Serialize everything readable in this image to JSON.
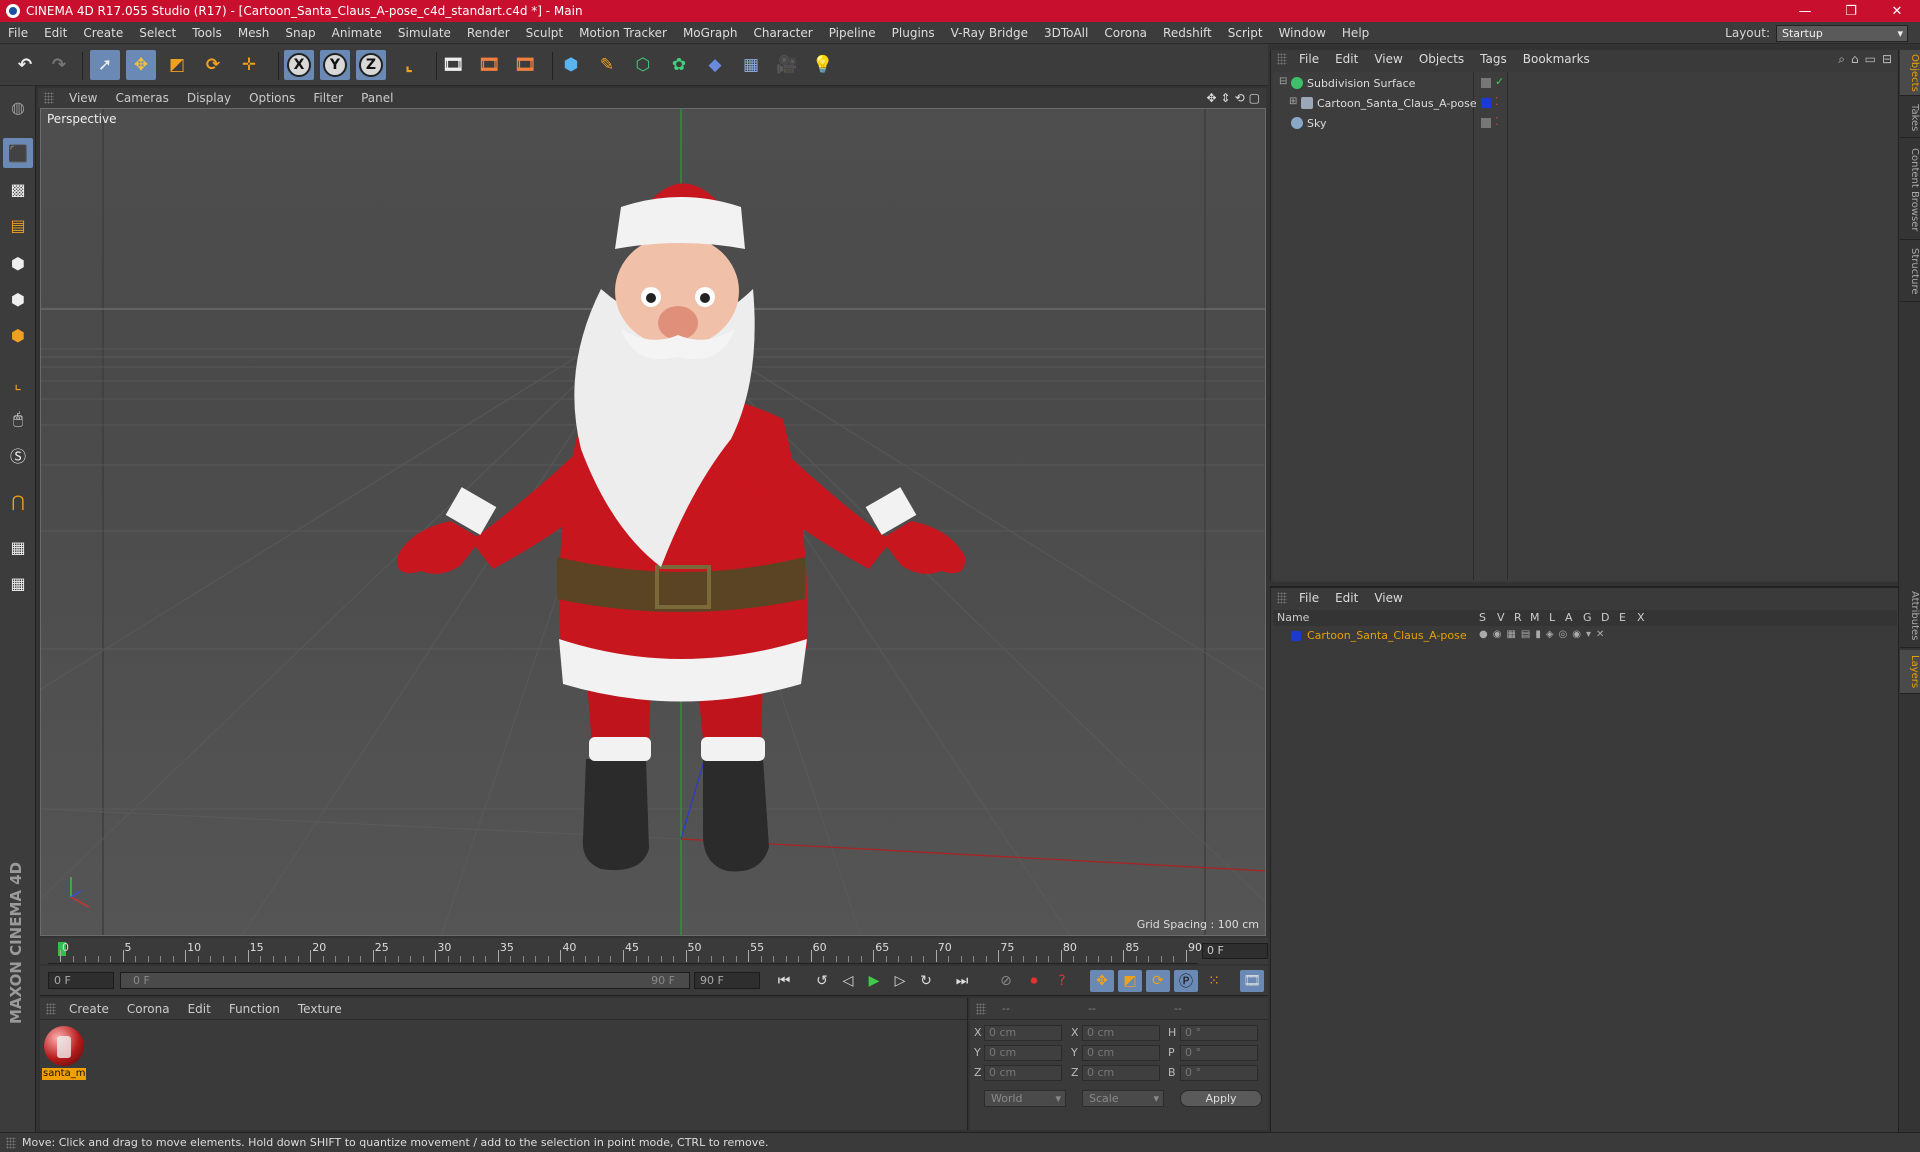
{
  "window": {
    "title": "CINEMA 4D R17.055 Studio (R17) - [Cartoon_Santa_Claus_A-pose_c4d_standart.c4d *] - Main",
    "controls": [
      "—",
      "❐",
      "✕"
    ]
  },
  "menubar": {
    "items": [
      "File",
      "Edit",
      "Create",
      "Select",
      "Tools",
      "Mesh",
      "Snap",
      "Animate",
      "Simulate",
      "Render",
      "Sculpt",
      "Motion Tracker",
      "MoGraph",
      "Character",
      "Pipeline",
      "Plugins",
      "V-Ray Bridge",
      "3DToAll",
      "Corona",
      "Redshift",
      "Script",
      "Window",
      "Help"
    ],
    "layout_label": "Layout:",
    "layout_value": "Startup"
  },
  "toolbar": {
    "axes": [
      "X",
      "Y",
      "Z"
    ]
  },
  "viewport": {
    "menu": [
      "View",
      "Cameras",
      "Display",
      "Options",
      "Filter",
      "Panel"
    ],
    "camera_label": "Perspective",
    "grid_spacing": "Grid Spacing : 100 cm"
  },
  "timeline": {
    "ticks": [
      0,
      5,
      10,
      15,
      20,
      25,
      30,
      35,
      40,
      45,
      50,
      55,
      60,
      65,
      70,
      75,
      80,
      85,
      90
    ],
    "current_frame": "0 F"
  },
  "transport": {
    "start_field": "0 F",
    "range_start": "0 F",
    "range_end": "90 F",
    "end_field": "90 F"
  },
  "material_panel": {
    "menu": [
      "Create",
      "Corona",
      "Edit",
      "Function",
      "Texture"
    ],
    "material_name": "santa_m"
  },
  "coord_panel": {
    "head": [
      "--",
      "--",
      "--"
    ],
    "rows": [
      {
        "a": "X",
        "v1": "0 cm",
        "b": "X",
        "v2": "0 cm",
        "c": "H",
        "v3": "0 °"
      },
      {
        "a": "Y",
        "v1": "0 cm",
        "b": "Y",
        "v2": "0 cm",
        "c": "P",
        "v3": "0 °"
      },
      {
        "a": "Z",
        "v1": "0 cm",
        "b": "Z",
        "v2": "0 cm",
        "c": "B",
        "v3": "0 °"
      }
    ],
    "space": "World",
    "mode": "Scale",
    "apply": "Apply"
  },
  "object_manager": {
    "menu": [
      "File",
      "Edit",
      "View",
      "Objects",
      "Tags",
      "Bookmarks"
    ],
    "objects": [
      {
        "name": "Subdivision Surface",
        "color": "#3fbf6a"
      },
      {
        "name": "Cartoon_Santa_Claus_A-pose",
        "color": "#9aa8b8"
      },
      {
        "name": "Sky",
        "color": "#8aa8c8"
      }
    ]
  },
  "right_tabs": [
    "Objects",
    "Takes",
    "Content Browser",
    "Structure",
    "Attributes",
    "Layers"
  ],
  "layer_manager": {
    "menu": [
      "File",
      "Edit",
      "View"
    ],
    "columns": [
      "Name",
      "S",
      "V",
      "R",
      "M",
      "L",
      "A",
      "G",
      "D",
      "E",
      "X"
    ],
    "layer": "Cartoon_Santa_Claus_A-pose"
  },
  "status": "Move: Click and drag to move elements. Hold down SHIFT to quantize movement / add to the selection in point mode, CTRL to remove.",
  "colors": {
    "title_red": "#c8102e",
    "accent_blue": "#6a89b4",
    "highlight_orange": "#e8a000"
  }
}
